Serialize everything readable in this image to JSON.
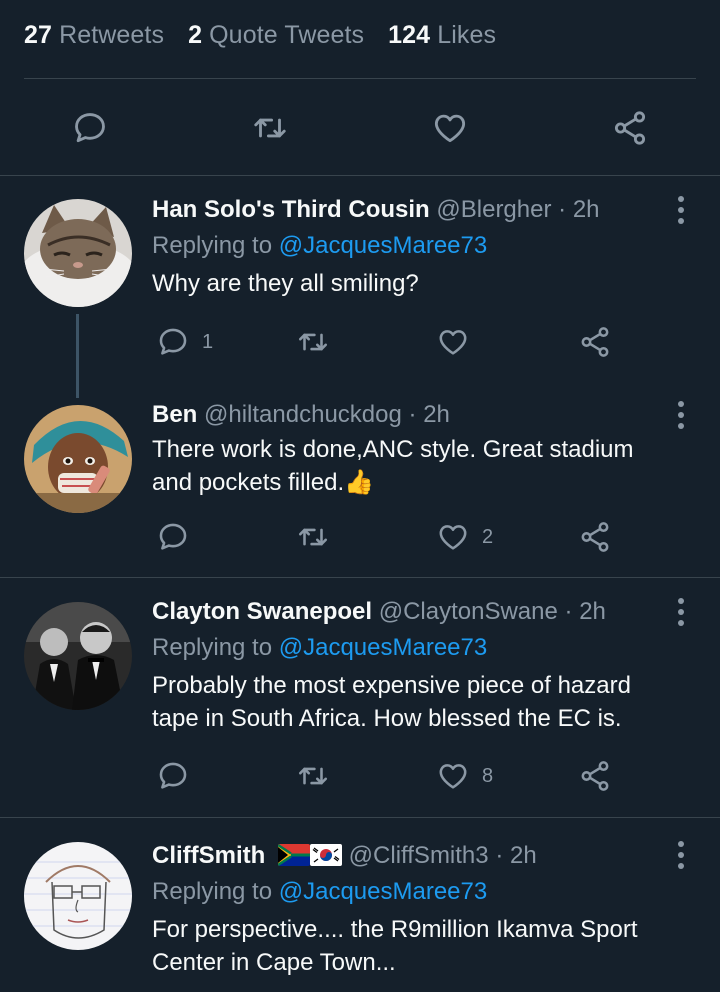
{
  "stats": {
    "retweets": {
      "num": "27",
      "label": "Retweets"
    },
    "quotes": {
      "num": "2",
      "label": "Quote Tweets"
    },
    "likes": {
      "num": "124",
      "label": "Likes"
    }
  },
  "icons": {
    "reply": "reply-icon",
    "retweet": "retweet-icon",
    "like": "heart-icon",
    "share": "share-icon",
    "more": "more-icon"
  },
  "colors": {
    "background": "#15202b",
    "muted": "#8b98a5",
    "link": "#1d9bf0",
    "divider": "#38444d",
    "thread_line": "#3d5466"
  },
  "replies": [
    {
      "name": "Han Solo's Third Cousin",
      "handle": "@Blergher",
      "dot": "·",
      "time": "2h",
      "replying_prefix": "Replying to",
      "replying_to": "@JacquesMaree73",
      "text": "Why are they all smiling?",
      "reply_count": "1",
      "retweet_count": "",
      "like_count": ""
    },
    {
      "name": "Ben",
      "handle": "@hiltandchuckdog",
      "dot": "·",
      "time": "2h",
      "text_line1": "There work is done,ANC style. Great stadium",
      "text_line2": "and pockets filled.",
      "emoji": "👍",
      "reply_count": "",
      "retweet_count": "",
      "like_count": "2"
    },
    {
      "name": "Clayton Swanepoel",
      "handle": "@ClaytonSwane",
      "dot": "·",
      "time": "2h",
      "replying_prefix": "Replying to",
      "replying_to": "@JacquesMaree73",
      "text_line1": "Probably the most expensive piece of hazard",
      "text_line2": "tape in South Africa. How blessed the EC is.",
      "reply_count": "",
      "retweet_count": "",
      "like_count": "8"
    },
    {
      "name": "CliffSmith",
      "flags": [
        "south-africa-flag",
        "south-korea-flag"
      ],
      "handle": "@CliffSmith3",
      "dot": "·",
      "time": "2h",
      "replying_prefix": "Replying to",
      "replying_to": "@JacquesMaree73",
      "text_line1": "For perspective.... the R9million Ikamva Sport",
      "text_line2": "Center in Cape Town..."
    }
  ]
}
